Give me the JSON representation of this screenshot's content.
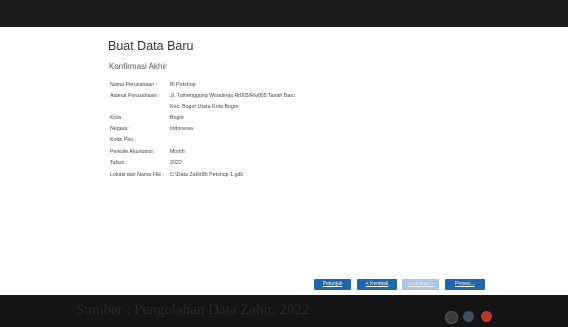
{
  "form": {
    "title": "Buat Data Baru",
    "subtitle": "Konfirmasi Akhir",
    "fields": [
      {
        "label": "Nama Perusahaan :",
        "value": "Bi Petshop"
      },
      {
        "label": "Alamat Perusahaan :",
        "value": "Jl. Tumenggung Wiradireja Rt003/Rw005 Tanah Baru"
      },
      {
        "label": "",
        "value": "Kec. Bogor Utara Kota Bogor"
      },
      {
        "label": "Kota :",
        "value": "Bogor"
      },
      {
        "label": "Negara :",
        "value": "Indonesia"
      },
      {
        "label": "Kode Pos :",
        "value": ""
      },
      {
        "label": "Periode Akuntansi :",
        "value": "Month"
      },
      {
        "label": "Tahun :",
        "value": "2022"
      },
      {
        "label": "Lokasi dan Nama File :",
        "value": "C:\\Data Zahir\\Bi Petshop 1.gdb"
      }
    ]
  },
  "buttons": {
    "help": "Petunjuk",
    "back": "< Kembali",
    "next": "Lanjutkan >",
    "process": "Proses..."
  },
  "caption": "Sumber : Pengolahan Data Zahir, 2022",
  "colors": {
    "accent": "#1f66ae",
    "disabled": "#a9c6e3"
  }
}
